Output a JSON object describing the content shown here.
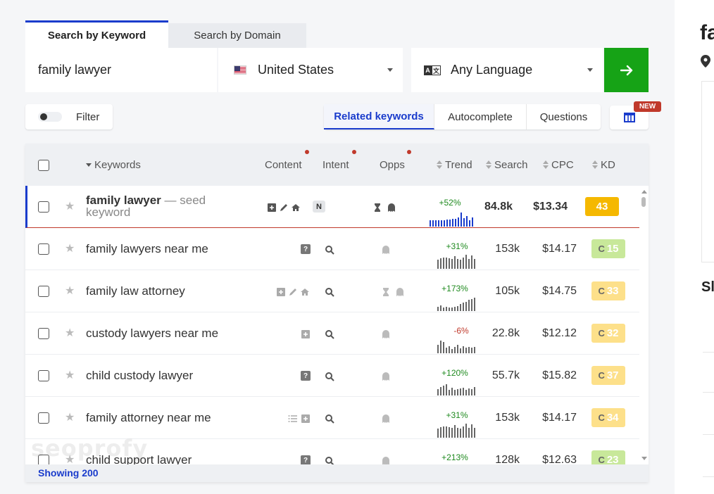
{
  "tabs": {
    "keyword": "Search by Keyword",
    "domain": "Search by Domain"
  },
  "search": {
    "keyword_value": "family lawyer",
    "country": "United States",
    "language": "Any Language",
    "go_icon": "arrow-right-icon"
  },
  "toolbar": {
    "filter_label": "Filter",
    "related_label": "Related keywords",
    "autocomplete_label": "Autocomplete",
    "questions_label": "Questions",
    "new_badge": "NEW"
  },
  "table": {
    "headers": {
      "keywords": "Keywords",
      "content": "Content",
      "intent": "Intent",
      "opps": "Opps",
      "trend": "Trend",
      "search": "Search",
      "cpc": "CPC",
      "kd": "KD"
    },
    "seed": {
      "keyword": "family lawyer",
      "suffix": "— seed keyword",
      "intent_badge": "N",
      "trend": "+52%",
      "search": "84.8k",
      "cpc": "$13.34",
      "kd": "43",
      "kd_color": "#f5b800"
    },
    "rows": [
      {
        "keyword": "family lawyers near me",
        "trend": "+31%",
        "search": "153k",
        "cpc": "$14.17",
        "kd": "15",
        "kd_color": "#c8e89a"
      },
      {
        "keyword": "family law attorney",
        "trend": "+173%",
        "search": "105k",
        "cpc": "$14.75",
        "kd": "33",
        "kd_color": "#fde08a"
      },
      {
        "keyword": "custody lawyers near me",
        "trend": "-6%",
        "search": "22.8k",
        "cpc": "$12.12",
        "kd": "32",
        "kd_color": "#fde08a"
      },
      {
        "keyword": "child custody lawyer",
        "trend": "+120%",
        "search": "55.7k",
        "cpc": "$15.82",
        "kd": "37",
        "kd_color": "#fde08a"
      },
      {
        "keyword": "family attorney near me",
        "trend": "+31%",
        "search": "153k",
        "cpc": "$14.17",
        "kd": "34",
        "kd_color": "#fde08a"
      },
      {
        "keyword": "child support lawyer",
        "trend": "+213%",
        "search": "128k",
        "cpc": "$12.63",
        "kd": "23",
        "kd_color": "#c8e89a"
      }
    ],
    "footer": "Showing 200"
  },
  "watermark": "seoprofy",
  "right_panel": {
    "title": "fa",
    "subtitle": "Sl"
  }
}
